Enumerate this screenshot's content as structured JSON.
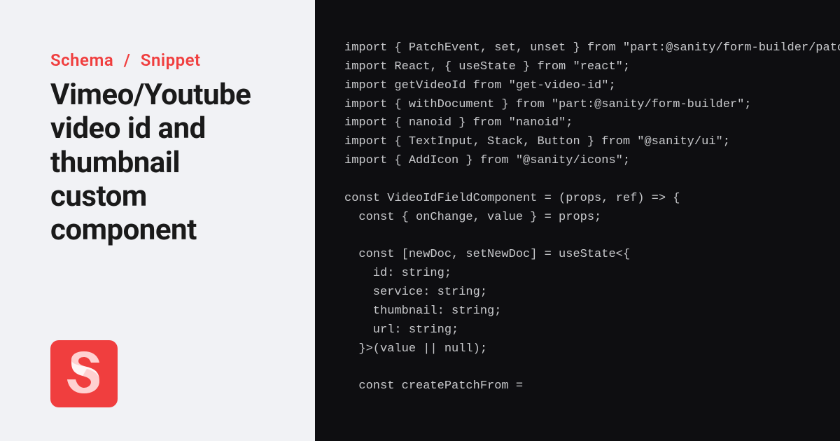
{
  "breadcrumb": {
    "category": "Schema",
    "separator": "/",
    "type": "Snippet"
  },
  "title": "Vimeo/Youtube video id and thumbnail custom component",
  "code": "import { PatchEvent, set, unset } from \"part:@sanity/form-builder/patch-event\";\nimport React, { useState } from \"react\";\nimport getVideoId from \"get-video-id\";\nimport { withDocument } from \"part:@sanity/form-builder\";\nimport { nanoid } from \"nanoid\";\nimport { TextInput, Stack, Button } from \"@sanity/ui\";\nimport { AddIcon } from \"@sanity/icons\";\n\nconst VideoIdFieldComponent = (props, ref) => {\n  const { onChange, value } = props;\n\n  const [newDoc, setNewDoc] = useState<{\n    id: string;\n    service: string;\n    thumbnail: string;\n    url: string;\n  }>(value || null);\n\n  const createPatchFrom ="
}
